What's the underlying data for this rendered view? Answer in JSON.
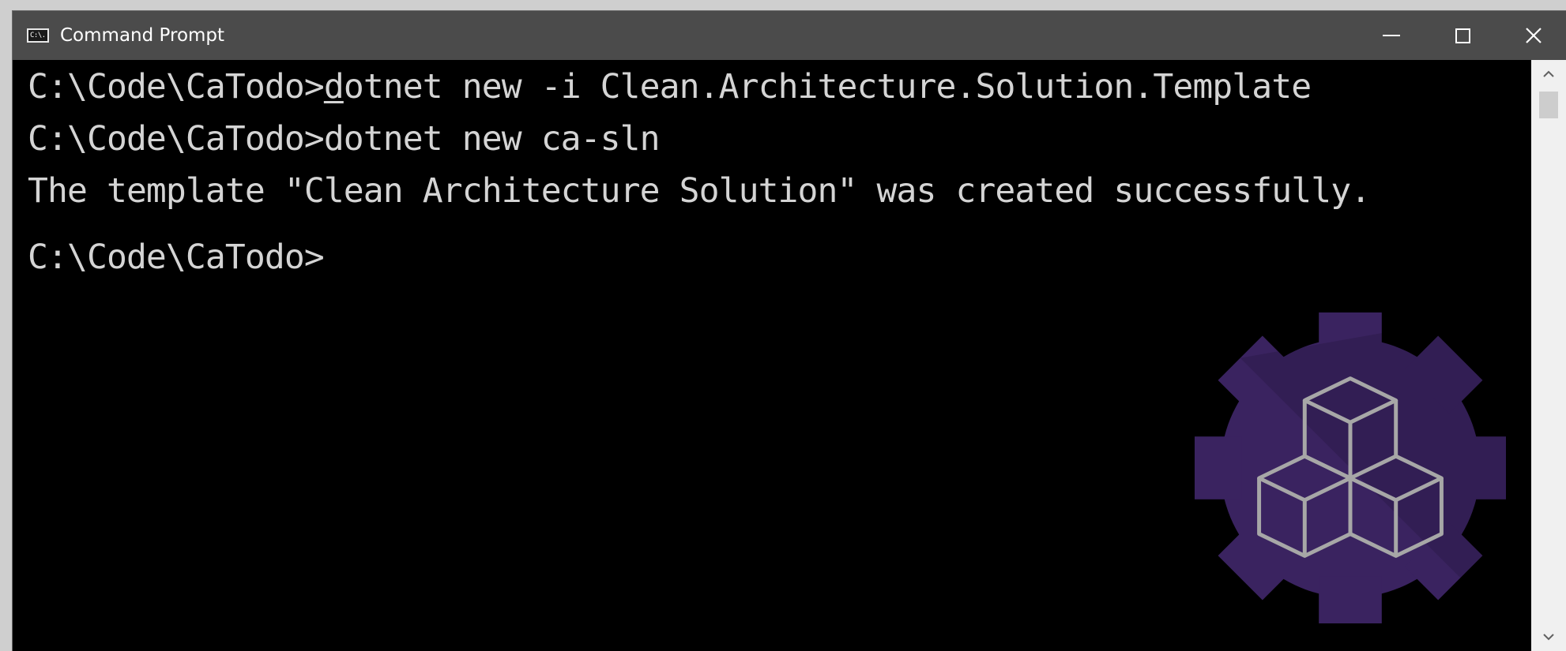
{
  "window": {
    "title": "Command Prompt",
    "icon": "cmd-icon",
    "icon_text": "C:\\."
  },
  "controls": {
    "minimize": "minimize-icon",
    "maximize": "maximize-icon",
    "close": "close-icon",
    "close_glyph": "✕"
  },
  "terminal": {
    "line1_prompt": "C:\\Code\\CaTodo>",
    "line1_cursor_char": "d",
    "line1_rest": "otnet new -i Clean.Architecture.Solution.Template",
    "line2": "C:\\Code\\CaTodo>dotnet new ca-sln",
    "line3": "The template \"Clean Architecture Solution\" was created successfully.",
    "line4": "C:\\Code\\CaTodo>"
  },
  "scrollbar": {
    "up_glyph": "^",
    "down_glyph": "v",
    "position_fraction": 0.0
  },
  "colors": {
    "titlebar": "#4b4b4b",
    "terminal_bg": "#000000",
    "terminal_text": "#d4d4d4",
    "logo_gear": "#3a2360",
    "logo_cubes": "#a7a7a7"
  },
  "logo": {
    "icon": "clean-architecture-logo"
  }
}
